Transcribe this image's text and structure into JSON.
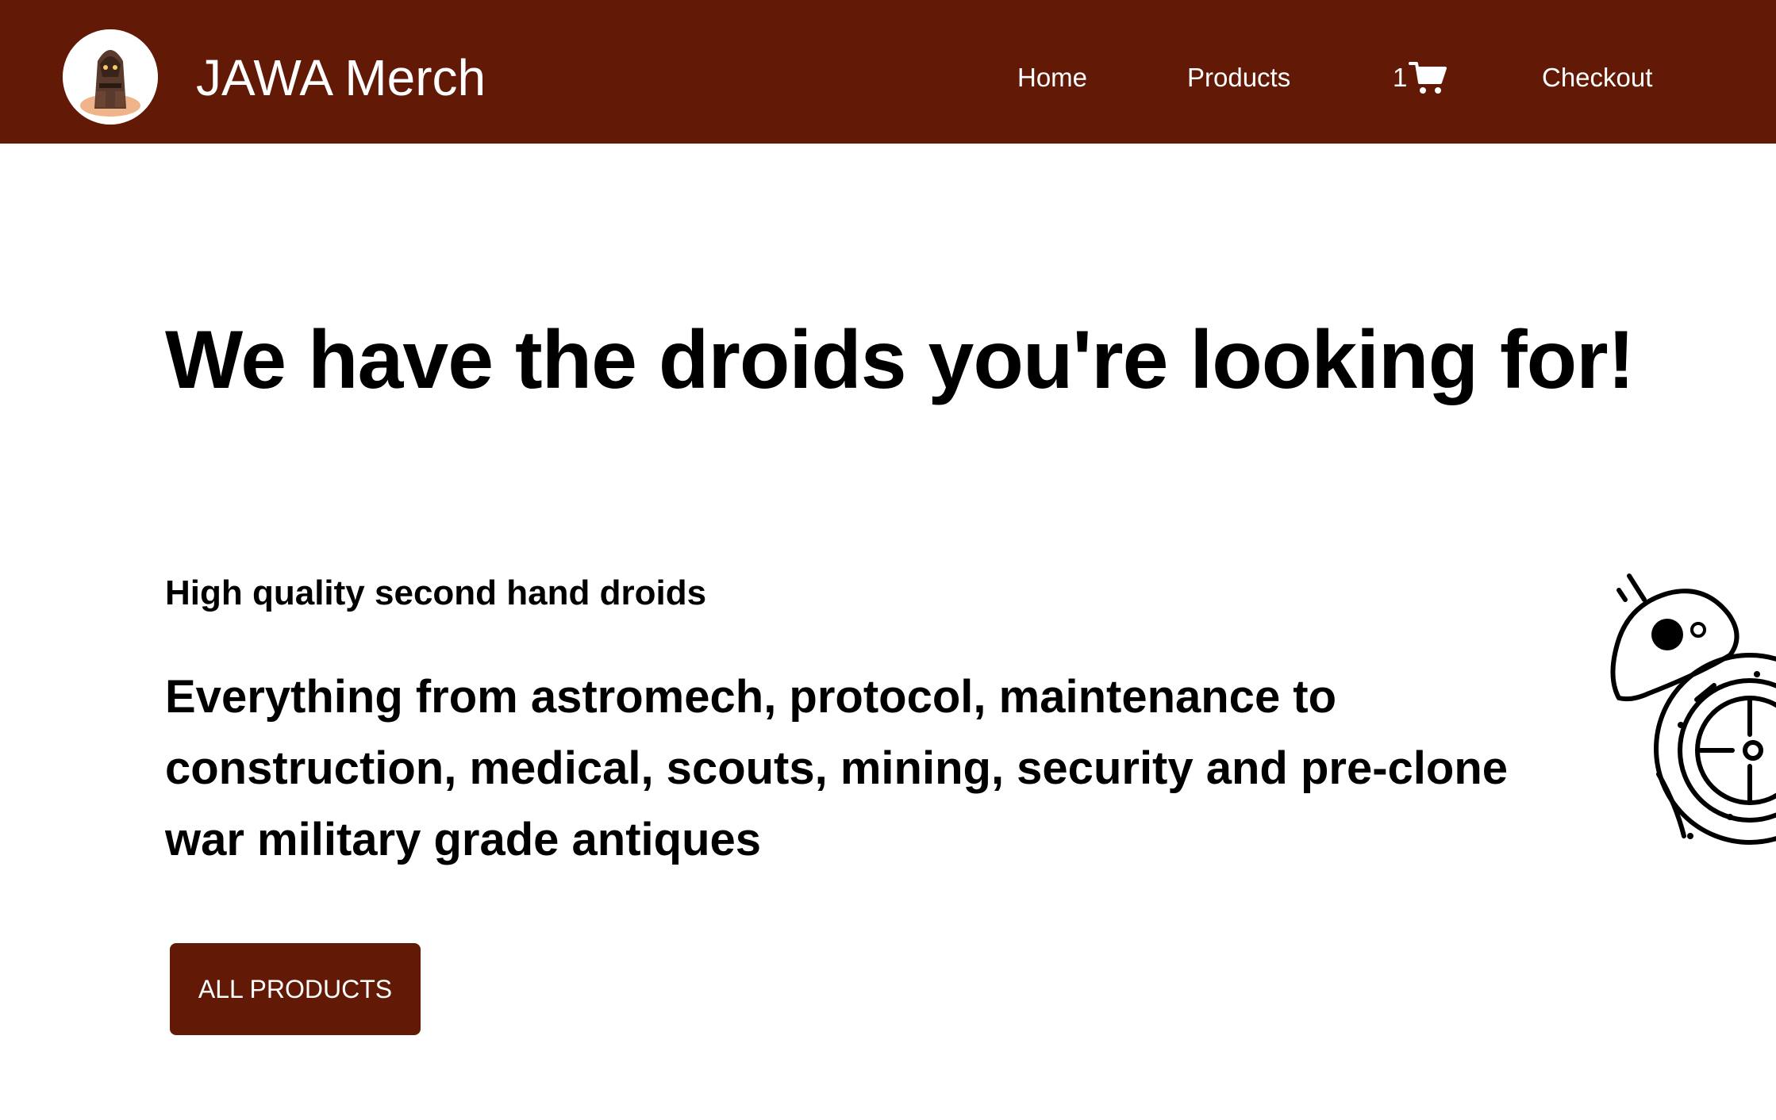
{
  "header": {
    "brand": "JAWA Merch",
    "logo_icon": "jawa-logo-icon",
    "nav": {
      "home": "Home",
      "products": "Products",
      "cart_count": "1",
      "cart_icon": "shopping-cart-icon",
      "checkout": "Checkout"
    }
  },
  "hero": {
    "title": "We have the droids you're looking for!",
    "subtitle": "High quality second hand droids",
    "description_lines": [
      "Everything from astromech, protocol, maintenance to",
      "construction, medical, scouts, mining, security and pre-clone",
      "war military grade antiques"
    ],
    "cta_label": "ALL PRODUCTS",
    "illustration_icon": "bb8-droid-icon"
  },
  "colors": {
    "brand": "#621a07",
    "header_text": "#ffffff",
    "background": "#ffffff",
    "text": "#000000"
  }
}
